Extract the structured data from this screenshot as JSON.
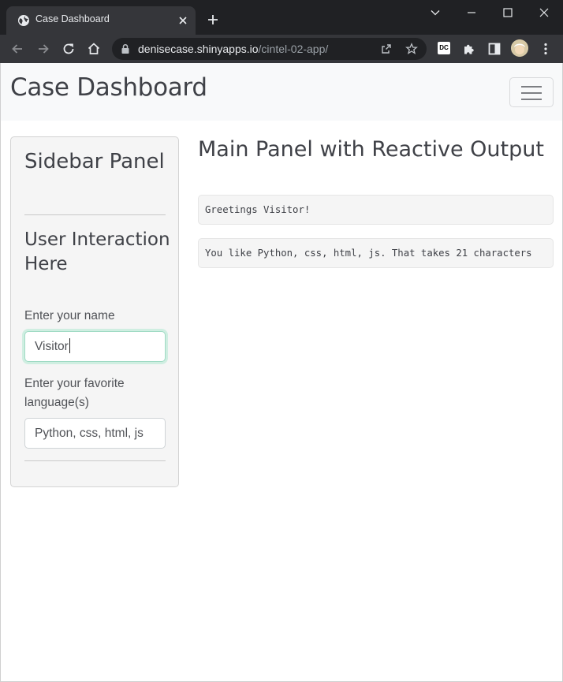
{
  "browser": {
    "tab_title": "Case Dashboard",
    "url_host": "denisecase.shinyapps.io",
    "url_path": "/cintel-02-app/",
    "extension_badge": "DC",
    "icons": [
      "globe-icon",
      "close-icon",
      "plus-icon",
      "chevron-down-icon",
      "minimize-icon",
      "maximize-icon",
      "close-window-icon",
      "back-arrow-icon",
      "forward-arrow-icon",
      "reload-icon",
      "home-icon",
      "lock-icon",
      "share-icon",
      "star-icon",
      "puzzle-icon",
      "sidepanel-icon",
      "kebab-menu-icon"
    ]
  },
  "navbar": {
    "brand": "Case Dashboard"
  },
  "sidebar": {
    "title": "Sidebar Panel",
    "subtitle": "User Interaction Here",
    "name_label": "Enter your name",
    "name_value": "Visitor",
    "language_label": "Enter your favorite language(s)",
    "language_value": "Python, css, html, js"
  },
  "main": {
    "title": "Main Panel with Reactive Output",
    "greeting_output": "Greetings Visitor!",
    "language_output": "You like Python, css, html, js. That takes 21 characters"
  }
}
